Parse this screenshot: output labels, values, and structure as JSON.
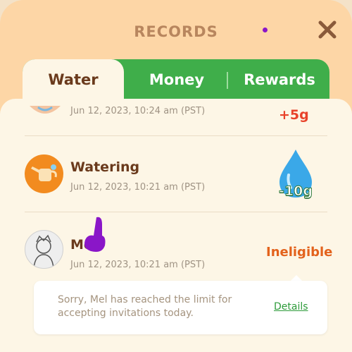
{
  "header": {
    "title": "RECORDS",
    "close_icon": "close-x-icon",
    "accent": "#b8865e"
  },
  "tabs": [
    {
      "label": "Water",
      "active": true
    },
    {
      "label": "Money",
      "active": false
    },
    {
      "label": "Rewards",
      "active": false
    }
  ],
  "records": [
    {
      "name": "",
      "date": "Jun 12, 2023, 10:24 am (PST)",
      "amount": "+5g",
      "amount_color": "#e8422a",
      "icon": "partial-avatar-icon"
    },
    {
      "name": "Watering",
      "date": "Jun 12, 2023, 10:21 am (PST)",
      "amount": "-10g",
      "amount_color": "#2e7a3a",
      "icon": "watering-can-icon",
      "badge_icon": "water-drop-icon"
    },
    {
      "name": "Mel",
      "date": "Jun 12, 2023, 10:21 am (PST)",
      "status": "Ineligible",
      "status_color": "#e3621c",
      "icon": "user-avatar-icon"
    }
  ],
  "tooltip": {
    "text": "Sorry, Mel has reached the limit for accepting invitations today.",
    "link": "Details"
  }
}
